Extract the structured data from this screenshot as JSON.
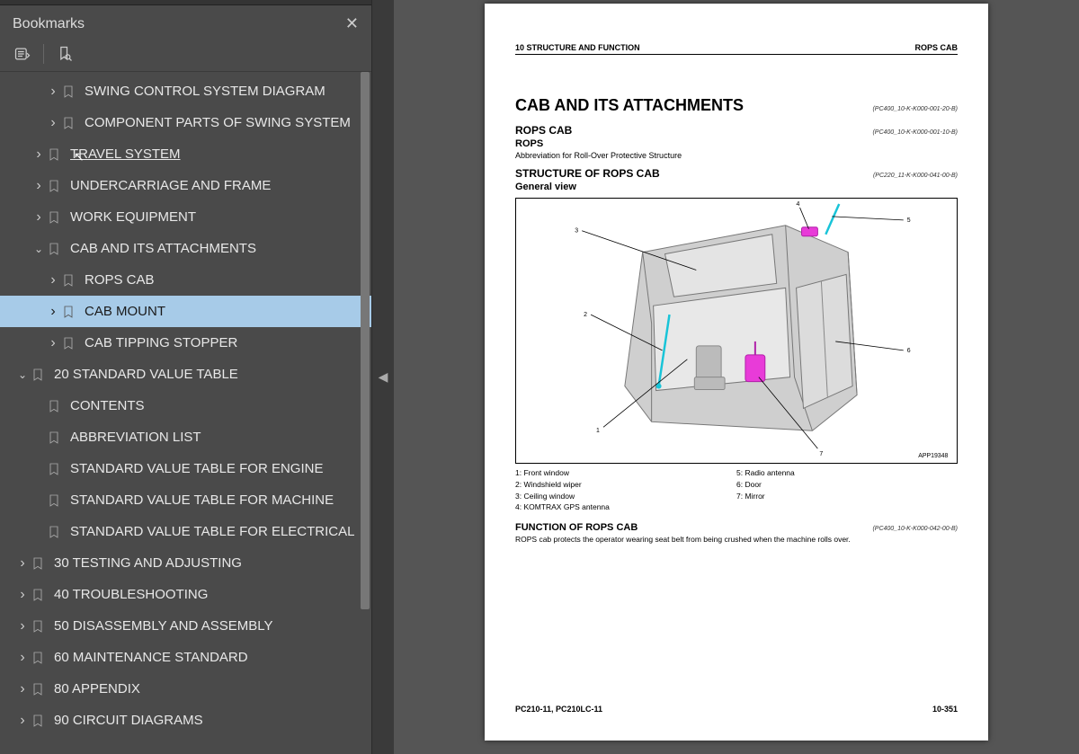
{
  "sidebar": {
    "title": "Bookmarks",
    "items": [
      {
        "indent": 2,
        "chev": "right",
        "label": "SWING CONTROL SYSTEM DIAGRAM"
      },
      {
        "indent": 2,
        "chev": "right",
        "label": "COMPONENT PARTS OF SWING SYSTEM"
      },
      {
        "indent": 1,
        "chev": "right",
        "label": "TRAVEL SYSTEM",
        "underline": true,
        "cursor": true
      },
      {
        "indent": 1,
        "chev": "right",
        "label": "UNDERCARRIAGE AND FRAME"
      },
      {
        "indent": 1,
        "chev": "right",
        "label": "WORK EQUIPMENT"
      },
      {
        "indent": 1,
        "chev": "down",
        "label": "CAB AND ITS ATTACHMENTS"
      },
      {
        "indent": 2,
        "chev": "right",
        "label": "ROPS CAB"
      },
      {
        "indent": 2,
        "chev": "right",
        "label": "CAB MOUNT",
        "selected": true
      },
      {
        "indent": 2,
        "chev": "right",
        "label": "CAB TIPPING STOPPER"
      },
      {
        "indent": 0,
        "chev": "down",
        "label": "20 STANDARD VALUE TABLE"
      },
      {
        "indent": 1,
        "chev": "none",
        "label": "CONTENTS"
      },
      {
        "indent": 1,
        "chev": "none",
        "label": "ABBREVIATION LIST"
      },
      {
        "indent": 1,
        "chev": "none",
        "label": "STANDARD VALUE TABLE FOR ENGINE"
      },
      {
        "indent": 1,
        "chev": "none",
        "label": "STANDARD VALUE TABLE FOR MACHINE"
      },
      {
        "indent": 1,
        "chev": "none",
        "label": "STANDARD VALUE TABLE FOR ELECTRICAL"
      },
      {
        "indent": 0,
        "chev": "right",
        "label": "30 TESTING AND ADJUSTING"
      },
      {
        "indent": 0,
        "chev": "right",
        "label": "40 TROUBLESHOOTING"
      },
      {
        "indent": 0,
        "chev": "right",
        "label": "50 DISASSEMBLY AND ASSEMBLY"
      },
      {
        "indent": 0,
        "chev": "right",
        "label": "60 MAINTENANCE STANDARD"
      },
      {
        "indent": 0,
        "chev": "right",
        "label": "80 APPENDIX"
      },
      {
        "indent": 0,
        "chev": "right",
        "label": "90 CIRCUIT DIAGRAMS"
      }
    ]
  },
  "doc": {
    "header_left": "10 STRUCTURE AND FUNCTION",
    "header_right": "ROPS CAB",
    "title": "CAB AND ITS ATTACHMENTS",
    "title_code": "(PC400_10-K-K000-001-20-B)",
    "sub1": "ROPS CAB",
    "sub1_code": "(PC400_10-K-K000-001-10-B)",
    "sub2": "ROPS",
    "sub2_desc": "Abbreviation for Roll-Over Protective Structure",
    "struct_h": "STRUCTURE OF ROPS CAB",
    "struct_code": "(PC220_11-K-K000-041-00-B)",
    "struct_sub": "General view",
    "diag_code": "APP19348",
    "legend_left": [
      "1: Front window",
      "2: Windshield wiper",
      "3: Ceiling window",
      "4: KOMTRAX GPS antenna"
    ],
    "legend_right": [
      "5: Radio antenna",
      "6: Door",
      "7: Mirror"
    ],
    "func_h": "FUNCTION OF ROPS CAB",
    "func_code": "(PC400_10-K-K000-042-00-B)",
    "func_text": "ROPS cab protects the operator wearing seat belt from being crushed when the machine rolls over.",
    "footer_left": "PC210-11, PC210LC-11",
    "footer_right": "10-351"
  }
}
